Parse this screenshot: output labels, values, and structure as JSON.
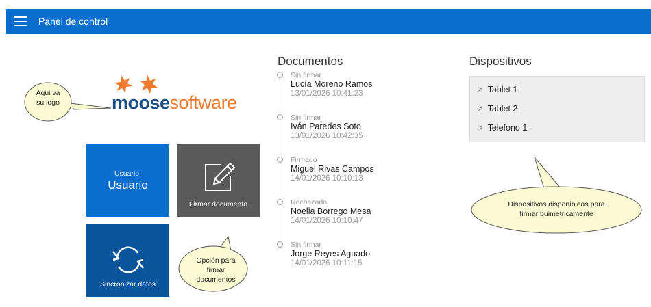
{
  "header": {
    "title": "Panel de control",
    "menu_icon": "hamburger-menu-icon"
  },
  "logo": {
    "text_bold": "moose",
    "text_light": "software",
    "annotation": "Aqui va\nsu logo"
  },
  "tiles": {
    "user": {
      "small": "Usuario:",
      "big": "Usuario"
    },
    "sign": {
      "label": "Firmar documento",
      "icon": "edit-document-icon"
    },
    "sync": {
      "label": "Sincronizar datos",
      "icon": "sync-icon"
    }
  },
  "sign_annotation": [
    "Opción para",
    "firmar",
    "documentos"
  ],
  "documents": {
    "title": "Documentos",
    "items": [
      {
        "status": "Sin firmar",
        "name": "Lucía Moreno Ramos",
        "date": "13/01/2026 10:41:23"
      },
      {
        "status": "Sin firmar",
        "name": "Iván Paredes Soto",
        "date": "13/01/2026 10:42:35"
      },
      {
        "status": "Firmado",
        "name": "Miguel Rivas Campos",
        "date": "14/01/2026 10:10:13"
      },
      {
        "status": "Rechazado",
        "name": "Noelia Borrego Mesa",
        "date": "14/01/2026 10:10:47"
      },
      {
        "status": "Sin firmar",
        "name": "Jorge Reyes Aguado",
        "date": "14/01/2026 10:11:15"
      }
    ]
  },
  "devices": {
    "title": "Dispositivos",
    "items": [
      "Tablet 1",
      "Tablet 2",
      "Telefono 1"
    ],
    "annotation": [
      "Dispositivos disponibleas para",
      "firmar buimetricamente"
    ]
  },
  "colors": {
    "primary": "#0a6ecf",
    "dark_tile": "#5a5a5a",
    "sync_tile": "#08559c",
    "logo_orange": "#f07b2e",
    "logo_blue": "#1a4f84",
    "bubble": "#fdfbd4"
  }
}
